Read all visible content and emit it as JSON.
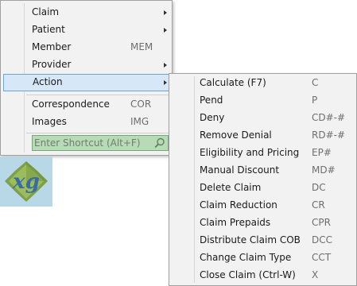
{
  "main_menu": {
    "items": [
      {
        "label": "Claim",
        "shortcut": "",
        "submenu": true
      },
      {
        "label": "Patient",
        "shortcut": "",
        "submenu": true
      },
      {
        "label": "Member",
        "shortcut": "MEM",
        "submenu": false
      },
      {
        "label": "Provider",
        "shortcut": "",
        "submenu": true
      },
      {
        "label": "Action",
        "shortcut": "",
        "submenu": true,
        "selected": true
      },
      {
        "label": "Correspondence",
        "shortcut": "COR",
        "submenu": false
      },
      {
        "label": "Images",
        "shortcut": "IMG",
        "submenu": false
      }
    ],
    "shortcut_placeholder": "Enter Shortcut (Alt+F)"
  },
  "action_submenu": {
    "items": [
      {
        "label": "Calculate (F7)",
        "shortcut": "C"
      },
      {
        "label": "Pend",
        "shortcut": "P"
      },
      {
        "label": "Deny",
        "shortcut": "CD#-#"
      },
      {
        "label": "Remove Denial",
        "shortcut": "RD#-#"
      },
      {
        "label": "Eligibility and Pricing",
        "shortcut": "EP#"
      },
      {
        "label": "Manual Discount",
        "shortcut": "MD#"
      },
      {
        "label": "Delete Claim",
        "shortcut": "DC"
      },
      {
        "label": "Claim Reduction",
        "shortcut": "CR"
      },
      {
        "label": "Claim Prepaids",
        "shortcut": "CPR"
      },
      {
        "label": "Distribute Claim COB",
        "shortcut": "DCC"
      },
      {
        "label": "Change Claim Type",
        "shortcut": "CCT"
      },
      {
        "label": "Close Claim (Ctrl-W)",
        "shortcut": "X"
      }
    ]
  },
  "logo": {
    "text": "xg"
  },
  "colors": {
    "menu_bg": "#f2f2f2",
    "selection_bg": "#d6e8f8",
    "selection_border": "#6ea3d8",
    "shortcut_box_bg": "#b6dbb6",
    "logo_bg": "#b8d8e8"
  }
}
